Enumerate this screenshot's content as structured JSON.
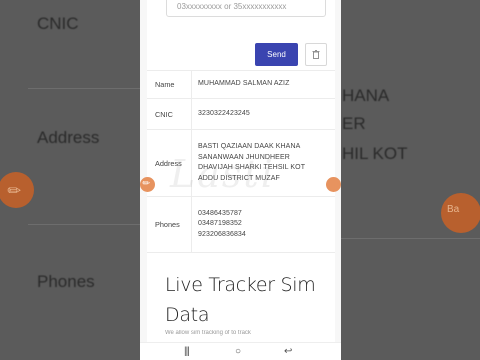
{
  "background": {
    "left_labels": [
      "CNIC",
      "Address",
      "Phones"
    ],
    "right_labels": [
      "HANA",
      "ER",
      "HIL KOT"
    ],
    "right_dot_label": "Ba"
  },
  "form": {
    "input_placeholder": "03xxxxxxxxx or 35xxxxxxxxxxx",
    "send_label": "Send"
  },
  "details": {
    "name_label": "Name",
    "name_value": "MUHAMMAD SALMAN AZIZ",
    "cnic_label": "CNIC",
    "cnic_value": "3230322423245",
    "address_label": "Address",
    "address_lines": [
      "BASTI QAZIAAN DAAK KHANA",
      "SANANWAAN JHUNDHEER",
      "DHAVIJAH SHARKI TEHSIL KOT",
      "ADDU DISTRICT MUZAF"
    ],
    "phones_label": "Phones",
    "phones": [
      "03486435787",
      "03487198352",
      "923206836834"
    ]
  },
  "section": {
    "title_line1": "Live Tracker Sim",
    "title_line2": "Data",
    "subtitle": "We allow sim tracking of to track"
  },
  "watermark": "Lasti",
  "navbar": {
    "recent_icon": "recent-apps-icon",
    "home_icon": "home-icon",
    "back_icon": "back-icon"
  },
  "colors": {
    "send_button": "#3a44b0",
    "accent_orange": "#e7935f",
    "bg_dark": "#5b5b5b"
  }
}
